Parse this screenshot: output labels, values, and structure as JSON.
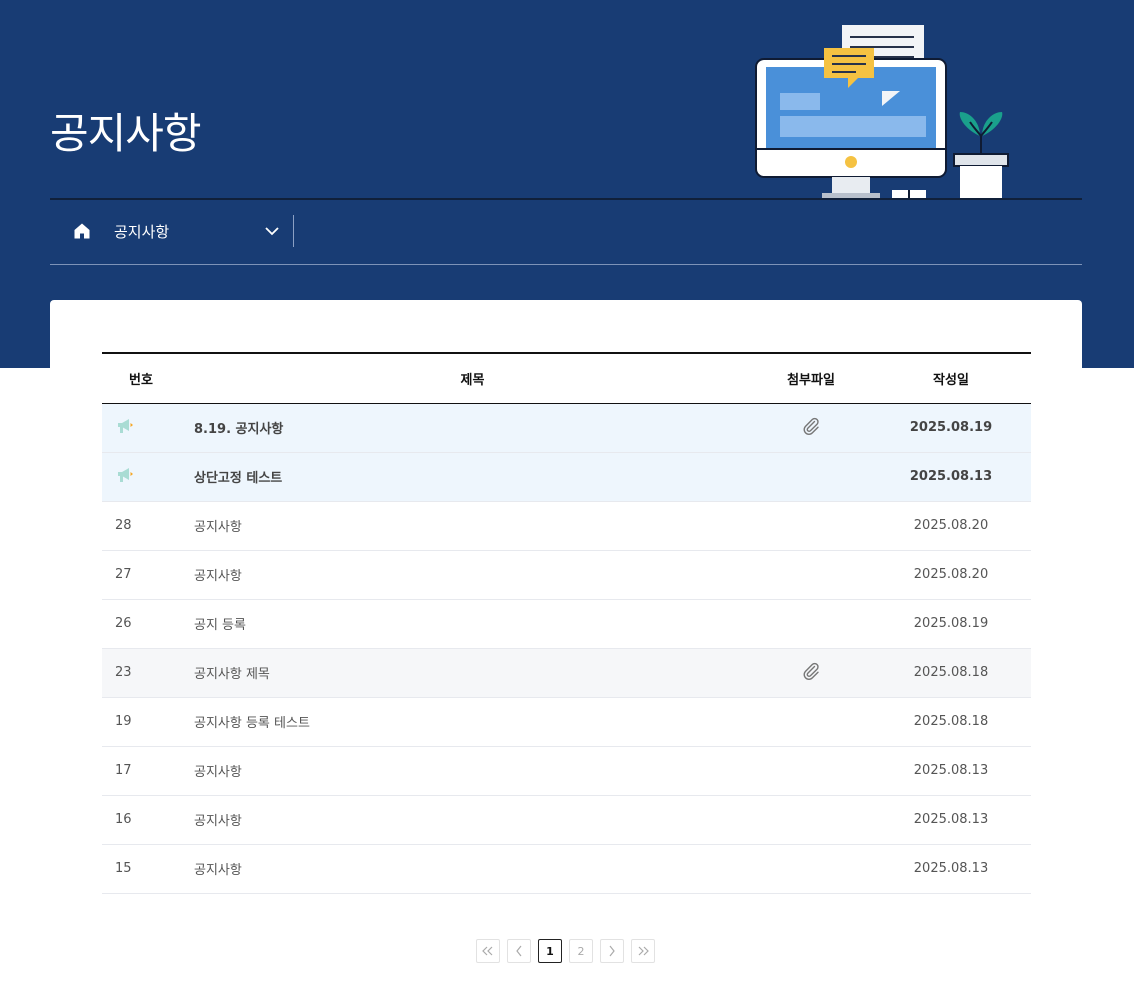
{
  "header": {
    "title": "공지사항",
    "location": {
      "current": "공지사항"
    }
  },
  "table": {
    "columns": {
      "num": "번호",
      "title": "제목",
      "attach": "첨부파일",
      "date": "작성일"
    },
    "rows": [
      {
        "num": "",
        "title": "8.19. 공지사항",
        "attach": true,
        "date": "2025.08.19",
        "pinned": true
      },
      {
        "num": "",
        "title": "상단고정 테스트",
        "attach": false,
        "date": "2025.08.13",
        "pinned": true
      },
      {
        "num": "28",
        "title": "공지사항",
        "attach": false,
        "date": "2025.08.20",
        "pinned": false
      },
      {
        "num": "27",
        "title": "공지사항",
        "attach": false,
        "date": "2025.08.20",
        "pinned": false
      },
      {
        "num": "26",
        "title": "공지 등록",
        "attach": false,
        "date": "2025.08.19",
        "pinned": false
      },
      {
        "num": "23",
        "title": "공지사항 제목",
        "attach": true,
        "date": "2025.08.18",
        "pinned": false
      },
      {
        "num": "19",
        "title": "공지사항 등록 테스트",
        "attach": false,
        "date": "2025.08.18",
        "pinned": false
      },
      {
        "num": "17",
        "title": "공지사항",
        "attach": false,
        "date": "2025.08.13",
        "pinned": false
      },
      {
        "num": "16",
        "title": "공지사항",
        "attach": false,
        "date": "2025.08.13",
        "pinned": false
      },
      {
        "num": "15",
        "title": "공지사항",
        "attach": false,
        "date": "2025.08.13",
        "pinned": false
      }
    ]
  },
  "pagination": {
    "first": "«",
    "prev": "‹",
    "pages": [
      "1",
      "2"
    ],
    "current": "1",
    "next": "›",
    "last": "»"
  },
  "icons": {
    "home": "home-icon",
    "chevron": "chevron-down-icon",
    "pinned": "megaphone-icon",
    "attachment": "paperclip-icon"
  },
  "colors": {
    "header_bg": "#183c74",
    "pinned_row_bg": "#eef6fd",
    "illustration_screen": "#4a90d9",
    "illustration_bubble": "#f5c242",
    "illustration_plant": "#1aa08c"
  }
}
